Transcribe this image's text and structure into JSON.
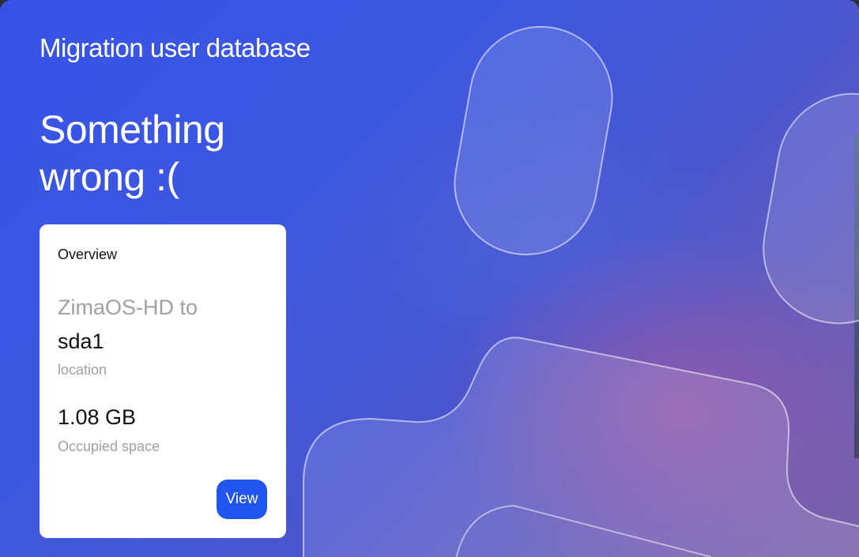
{
  "dialog": {
    "title": "Migration user database",
    "headline_line1": "Something",
    "headline_line2": "wrong :(",
    "accent_color": "#2155f0"
  },
  "overview": {
    "heading": "Overview",
    "source": "ZimaOS-HD to",
    "destination": "sda1",
    "location_label": "location",
    "occupied_value": "1.08 GB",
    "occupied_label": "Occupied space",
    "view_label": "View"
  }
}
